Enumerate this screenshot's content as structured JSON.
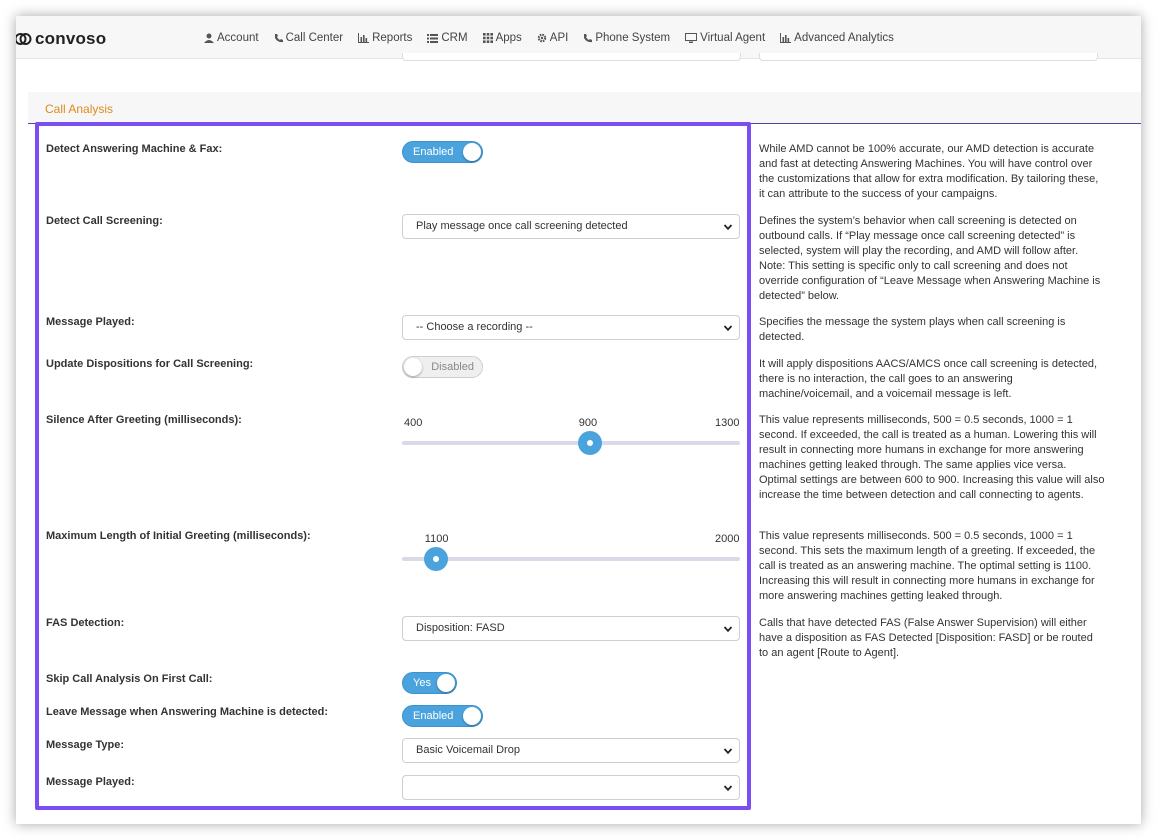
{
  "brand": {
    "name": "convoso"
  },
  "nav": [
    {
      "label": "Account",
      "icon": "user-icon"
    },
    {
      "label": "Call Center",
      "icon": "phone-icon"
    },
    {
      "label": "Reports",
      "icon": "bar-chart-icon"
    },
    {
      "label": "CRM",
      "icon": "list-icon"
    },
    {
      "label": "Apps",
      "icon": "grid-icon"
    },
    {
      "label": "API",
      "icon": "gear-icon"
    },
    {
      "label": "Phone System",
      "icon": "phone-icon"
    },
    {
      "label": "Virtual Agent",
      "icon": "monitor-icon"
    },
    {
      "label": "Advanced Analytics",
      "icon": "bar-chart-icon"
    }
  ],
  "section": {
    "title": "Call Analysis"
  },
  "colors": {
    "accent": "#4ba3de",
    "section_title": "#e08a1e",
    "highlight": "#7a4ef0"
  },
  "fields": {
    "detect_amd": {
      "label": "Detect Answering Machine & Fax:",
      "value": "Enabled",
      "help": "While AMD cannot be 100% accurate, our AMD detection is accurate and fast at detecting Answering Machines. You will have control over the customizations that allow for extra modification. By tailoring these, it can attribute to the success of your campaigns."
    },
    "detect_screening": {
      "label": "Detect Call Screening:",
      "value": "Play message once call screening detected",
      "help": "Defines the system’s behavior when call screening is detected on outbound calls. If “Play message once call screening detected” is selected, system will play the recording, and AMD will follow after. Note: This setting is specific only to call screening and does not override configuration of “Leave Message when Answering Machine is detected” below."
    },
    "message_played": {
      "label": "Message Played:",
      "value": "-- Choose a recording --",
      "help": "Specifies the message the system plays when call screening is detected."
    },
    "update_dispositions": {
      "label": "Update Dispositions for Call Screening:",
      "value": "Disabled",
      "help": "It will apply dispositions AACS/AMCS once call screening is detected, there is no interaction, the call goes to an answering machine/voicemail, and a voicemail message is left."
    },
    "silence_after": {
      "label": "Silence After Greeting (milliseconds):",
      "min_label": "400",
      "value_label": "900",
      "max_label": "1300",
      "min": 400,
      "max": 1300,
      "value": 900,
      "help": "This value represents milliseconds, 500 =  0.5 seconds, 1000 = 1 second. If exceeded, the call is treated as a human. Lowering this will result in connecting more humans in exchange for more answering machines getting leaked through. The same applies vice versa. Optimal settings are between 600 to 900. Increasing this value will also increase the time between detection and call connecting to agents."
    },
    "max_greeting": {
      "label": "Maximum Length of Initial Greeting (milliseconds):",
      "value_label": "1100",
      "max_label": "2000",
      "min": 1000,
      "max": 2000,
      "value": 1100,
      "help": "This value represents milliseconds. 500 =  0.5 seconds, 1000 = 1 second. This sets the maximum length of a greeting. If exceeded, the call is treated as an answering machine. The optimal setting is 1100. Increasing this will result in connecting more humans in exchange for more answering machines getting leaked through."
    },
    "fas_detection": {
      "label": "FAS Detection:",
      "value": "Disposition: FASD",
      "help": "Calls that have detected FAS (False Answer Supervision) will either have a disposition as FAS Detected [Disposition: FASD] or be routed to an agent [Route to Agent]."
    },
    "skip_first": {
      "label": "Skip Call Analysis On First Call:",
      "value": "Yes"
    },
    "leave_message": {
      "label": "Leave Message when Answering Machine is detected:",
      "value": "Enabled"
    },
    "message_type": {
      "label": "Message Type:",
      "value": "Basic Voicemail Drop"
    },
    "message_played_2": {
      "label": "Message Played:",
      "value": ""
    }
  }
}
